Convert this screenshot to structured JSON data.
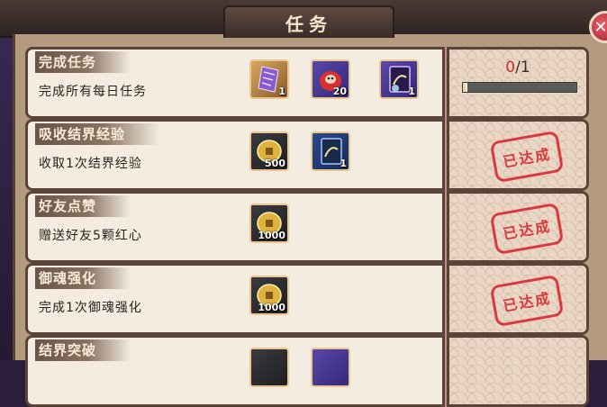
{
  "window": {
    "title": "任务"
  },
  "tasks": [
    {
      "name": "完成任务",
      "description": "完成所有每日任务",
      "rewards": [
        {
          "icon": "purple-charm-icon",
          "qty": "1"
        },
        {
          "icon": "red-daruma-icon",
          "qty": "20"
        },
        {
          "icon": "mystery-card-icon",
          "qty": "1"
        }
      ],
      "status": "progress",
      "progress": {
        "current": "0",
        "sep": "/",
        "total": "1",
        "fraction": 0.0
      }
    },
    {
      "name": "吸收结界经验",
      "description": "收取1次结界经验",
      "rewards": [
        {
          "icon": "gold-coin-icon",
          "qty": "500"
        },
        {
          "icon": "exp-card-icon",
          "qty": "1"
        }
      ],
      "status": "done",
      "stamp": "已达成"
    },
    {
      "name": "好友点赞",
      "description": "赠送好友5颗红心",
      "rewards": [
        {
          "icon": "gold-coin-icon",
          "qty": "1000"
        }
      ],
      "status": "done",
      "stamp": "已达成"
    },
    {
      "name": "御魂强化",
      "description": "完成1次御魂强化",
      "rewards": [
        {
          "icon": "gold-coin-icon",
          "qty": "1000"
        }
      ],
      "status": "done",
      "stamp": "已达成"
    },
    {
      "name": "结界突破",
      "description": "",
      "rewards": [],
      "status": "partial"
    }
  ],
  "colors": {
    "stamp_red": "#d82a32",
    "progress_red": "#d42a2a",
    "panel_bg": "#f4ece0"
  }
}
